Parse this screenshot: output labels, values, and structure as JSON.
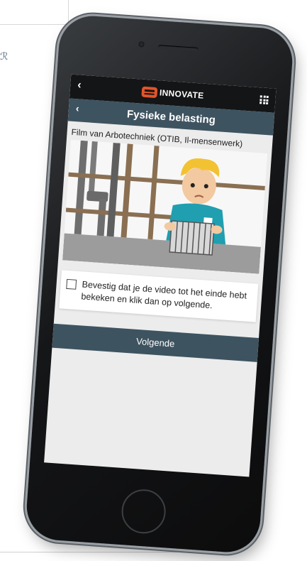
{
  "background": {
    "glyph": "ℛ"
  },
  "app": {
    "back_label": "‹",
    "brand": "INNOVATE",
    "brand_color": "#e2542a",
    "menu_icon": "grid-icon"
  },
  "page": {
    "back_label": "‹",
    "title": "Fysieke belasting"
  },
  "video": {
    "caption": "Film van Arbotechniek (OTIB, Il-mensenwerk)"
  },
  "confirm": {
    "checked": false,
    "text": "Bevestig dat je de video tot het einde hebt bekeken en klik dan op volgende."
  },
  "actions": {
    "next_label": "Volgende"
  },
  "colors": {
    "header_dark": "#141516",
    "title_bar": "#3e5360",
    "button": "#3e5360"
  }
}
